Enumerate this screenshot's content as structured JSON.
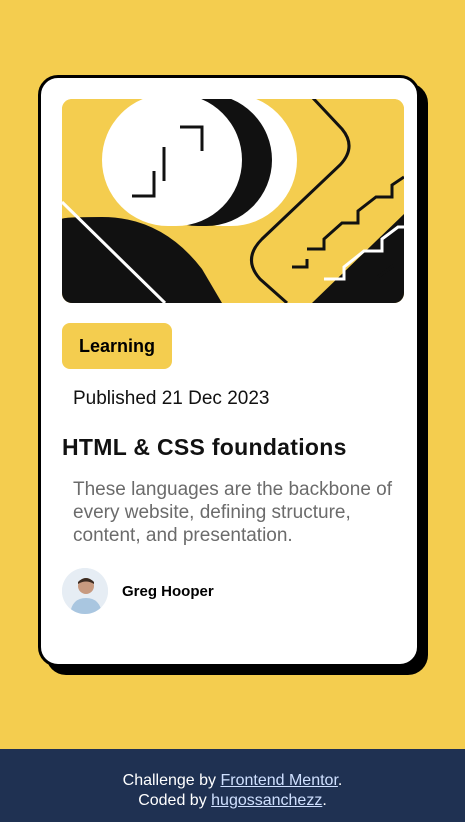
{
  "card": {
    "tag": "Learning",
    "published": "Published 21 Dec 2023",
    "title": "HTML & CSS foundations",
    "description": "These languages are the backbone of every website, defining structure, content, and presentation.",
    "author": "Greg Hooper"
  },
  "footer": {
    "line1_prefix": "Challenge by ",
    "line1_link": "Frontend Mentor",
    "line1_suffix": ".",
    "line2_prefix": "Coded by ",
    "line2_link": "hugossanchezz",
    "line2_suffix": "."
  },
  "colors": {
    "background": "#F4CD4F",
    "footer_bg": "#1F3152",
    "card_bg": "#FFFFFF",
    "text_dark": "#111111",
    "text_muted": "#6B6B6B"
  },
  "icons": {
    "avatar": "person-portrait"
  }
}
